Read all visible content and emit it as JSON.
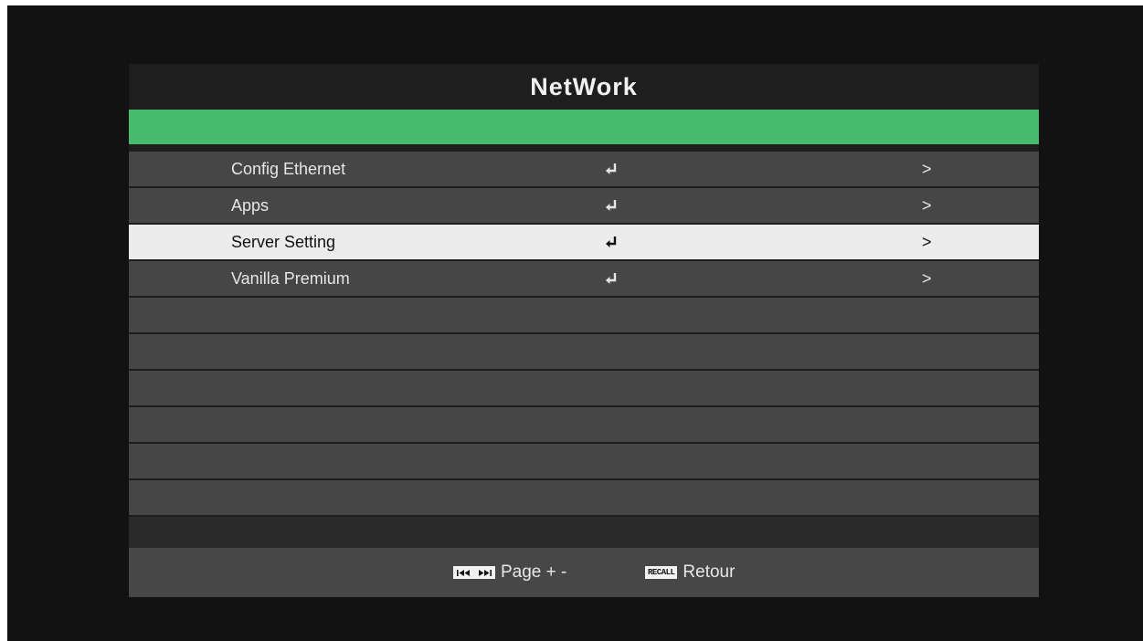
{
  "title": "NetWork",
  "menu": {
    "items": [
      {
        "label": "Config Ethernet",
        "enter_icon": "enter-icon",
        "arrow": ">"
      },
      {
        "label": "Apps",
        "enter_icon": "enter-icon",
        "arrow": ">"
      },
      {
        "label": "Server Setting",
        "enter_icon": "enter-icon",
        "arrow": ">",
        "selected": true
      },
      {
        "label": "Vanilla Premium",
        "enter_icon": "enter-icon",
        "arrow": ">"
      }
    ],
    "empty_rows": 6
  },
  "footer": {
    "page_hint": "Page + -",
    "page_key_icon": "skip-prev-next-icon",
    "recall_key_label": "RECALL",
    "recall_hint": "Retour"
  },
  "colors": {
    "accent": "#45bb6b",
    "row": "#464646",
    "selected_row": "#ececec",
    "panel": "#1e1e1e",
    "background": "#121212"
  }
}
